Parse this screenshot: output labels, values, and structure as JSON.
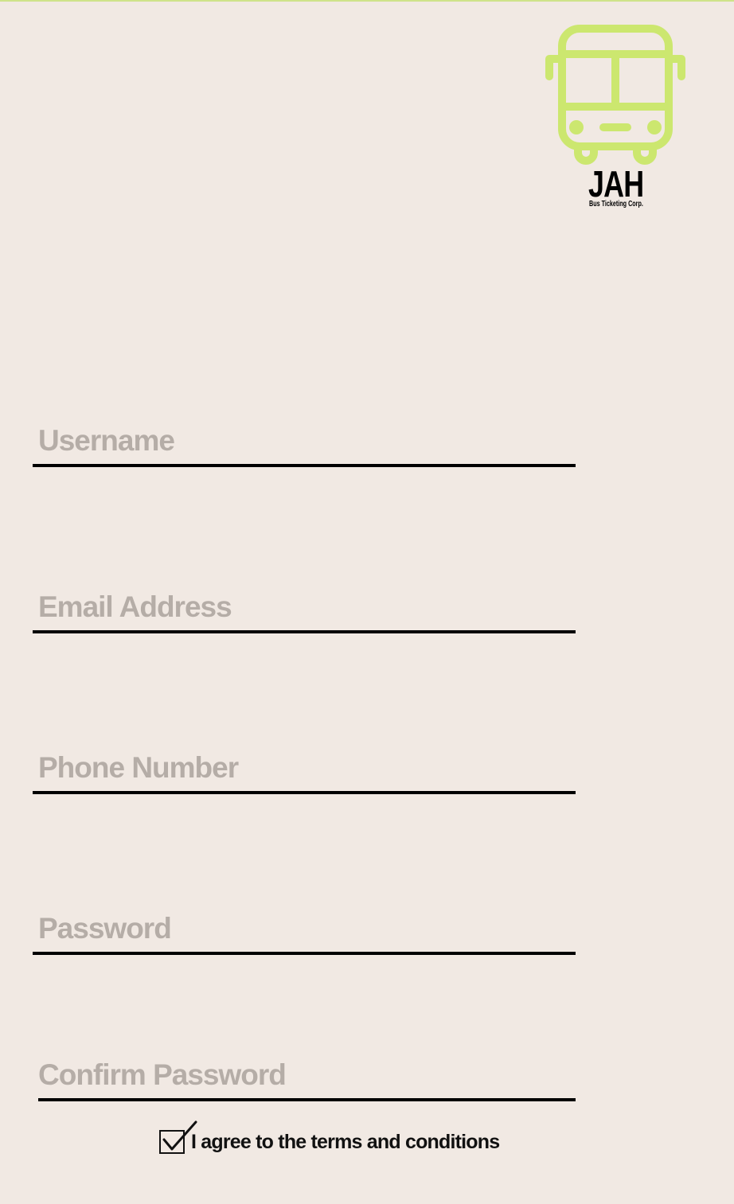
{
  "brand": {
    "name": "JAH",
    "tagline": "Bus Ticketing Corp.",
    "accent_color": "#cce76f",
    "icon": "bus-icon"
  },
  "form": {
    "username": {
      "placeholder": "Username",
      "value": ""
    },
    "email": {
      "placeholder": "Email Address",
      "value": ""
    },
    "phone": {
      "placeholder": "Phone Number",
      "value": ""
    },
    "password": {
      "placeholder": "Password",
      "value": ""
    },
    "confirm_password": {
      "placeholder": "Confirm Password",
      "value": ""
    },
    "terms": {
      "label": "I agree to the terms and conditions",
      "checked": true
    }
  },
  "colors": {
    "background": "#f1e9e3",
    "placeholder": "#b5ada7",
    "underline": "#000000"
  }
}
